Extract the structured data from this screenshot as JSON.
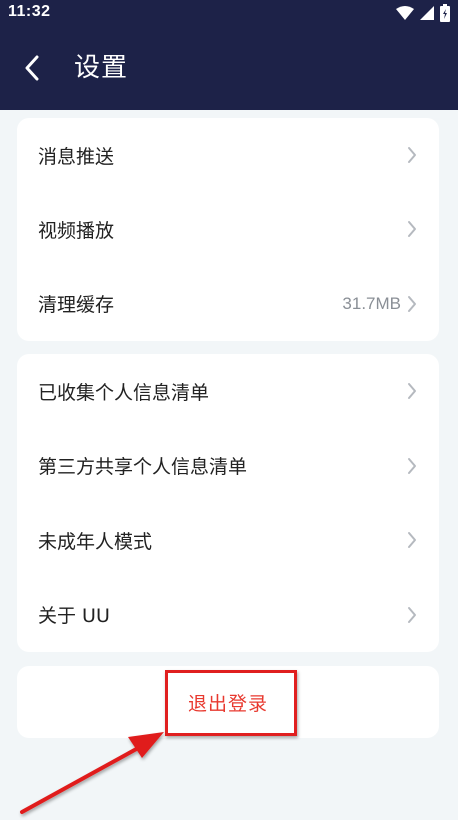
{
  "status_bar": {
    "time": "11:32"
  },
  "header": {
    "title": "设置"
  },
  "groups": [
    {
      "items": [
        {
          "label": "消息推送"
        },
        {
          "label": "视频播放"
        },
        {
          "label": "清理缓存",
          "value": "31.7MB"
        }
      ]
    },
    {
      "items": [
        {
          "label": "已收集个人信息清单"
        },
        {
          "label": "第三方共享个人信息清单"
        },
        {
          "label": "未成年人模式"
        },
        {
          "label": "关于 UU"
        }
      ]
    }
  ],
  "logout": {
    "label": "退出登录"
  },
  "colors": {
    "header_bg": "#1d2248",
    "page_bg": "#f2f6f8",
    "logout_text": "#e8392f",
    "annotation": "#e01f1f"
  }
}
